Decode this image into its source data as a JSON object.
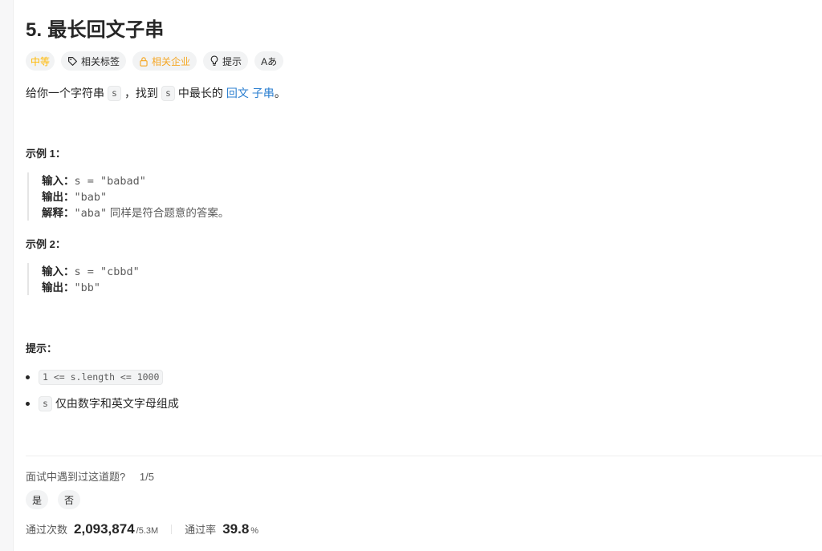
{
  "problem": {
    "title": "5. 最长回文子串"
  },
  "tags": {
    "difficulty": "中等",
    "related_tags": "相关标签",
    "related_companies": "相关企业",
    "hint": "提示",
    "lang": "Aあ"
  },
  "description": {
    "p1": "给你一个字符串",
    "var1": "s",
    "p2": "，找到",
    "var2": "s",
    "p3": "中最长的",
    "link1": "回文",
    "link2": "子串",
    "p4": "。"
  },
  "examples": [
    {
      "label": "示例 1：",
      "input_key": "输入：",
      "input_val": "s = \"babad\"",
      "output_key": "输出：",
      "output_val": "\"bab\"",
      "explain_key": "解释：",
      "explain_val": "\"aba\"",
      "explain_text": " 同样是符合题意的答案。"
    },
    {
      "label": "示例 2：",
      "input_key": "输入：",
      "input_val": "s = \"cbbd\"",
      "output_key": "输出：",
      "output_val": "\"bb\""
    }
  ],
  "constraints": {
    "label": "提示：",
    "items": [
      {
        "code": "1 <= s.length <= 1000",
        "text": ""
      },
      {
        "code": "s",
        "text": "仅由数字和英文字母组成"
      }
    ]
  },
  "interview": {
    "question": "面试中遇到过这道题?",
    "fraction": "1/5",
    "yes": "是",
    "no": "否"
  },
  "stats": {
    "accepted_label": "通过次数",
    "accepted_value": "2,093,874",
    "submissions": "/5.3M",
    "rate_label": "通过率",
    "rate_value": "39.8",
    "rate_unit": "%"
  }
}
